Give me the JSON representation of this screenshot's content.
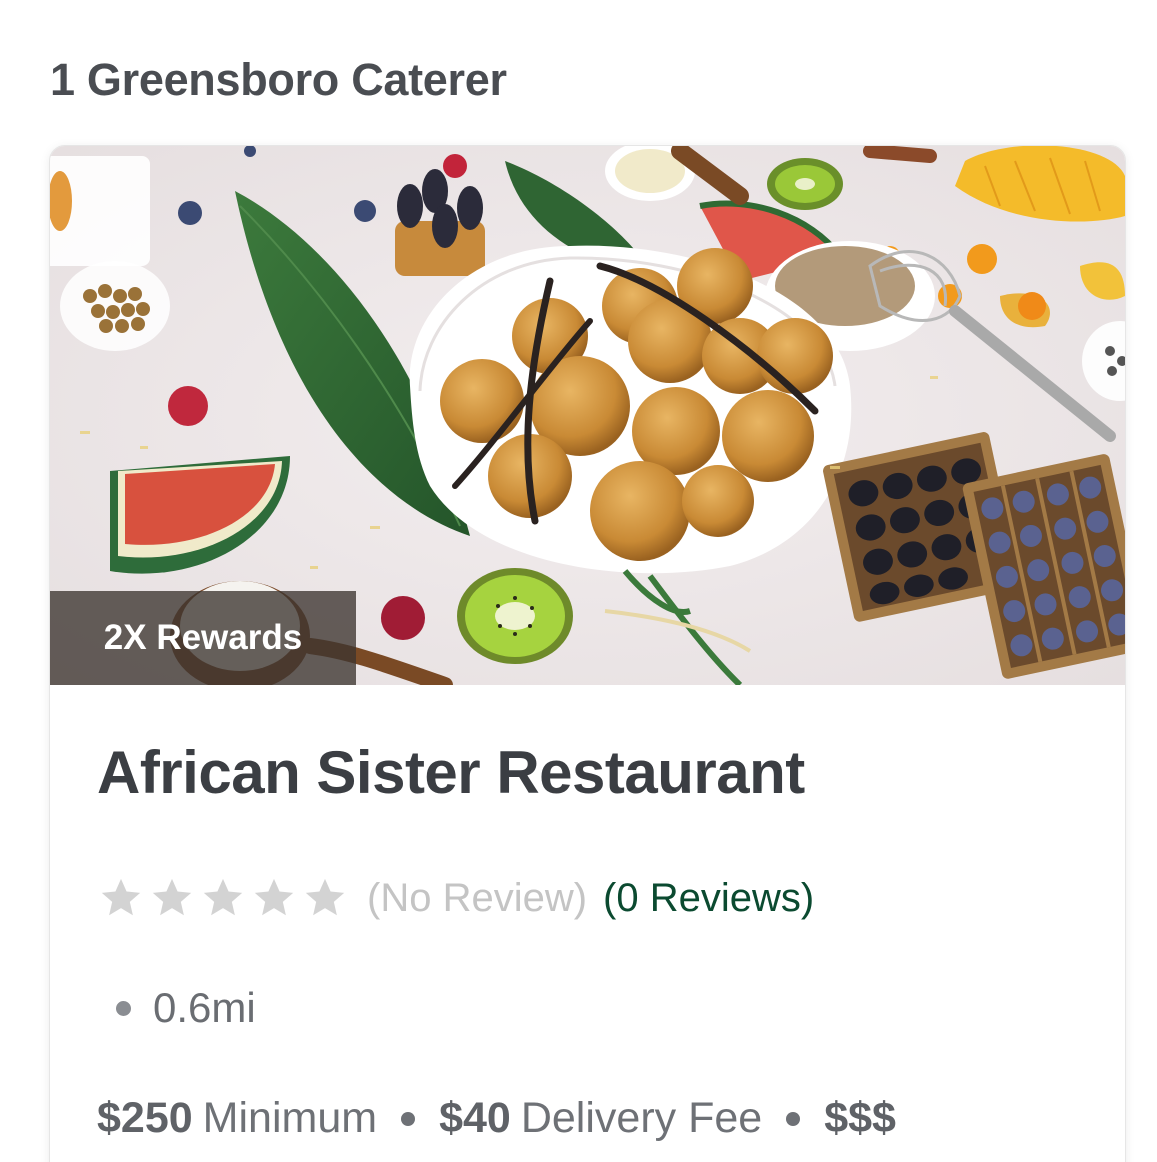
{
  "header": {
    "result_count": "1 Greensboro Caterer"
  },
  "card": {
    "badge": "2X Rewards",
    "name": "African Sister Restaurant",
    "rating": {
      "stars_filled": 0,
      "stars_total": 5,
      "no_review_text": "(No Review)",
      "reviews_link": "(0 Reviews)"
    },
    "distance": "0.6mi",
    "minimum_value": "$250",
    "minimum_label": "Minimum",
    "delivery_fee_value": "$40",
    "delivery_fee_label": "Delivery Fee",
    "price_level": "$$$"
  },
  "icons": {
    "star": "star-icon",
    "separator": "bullet-dot"
  },
  "colors": {
    "title": "#4a4d52",
    "name": "#3b3e43",
    "star_empty": "#d3d3d3",
    "reviews_link": "#0b4a30",
    "badge_bg": "#3c3430"
  }
}
